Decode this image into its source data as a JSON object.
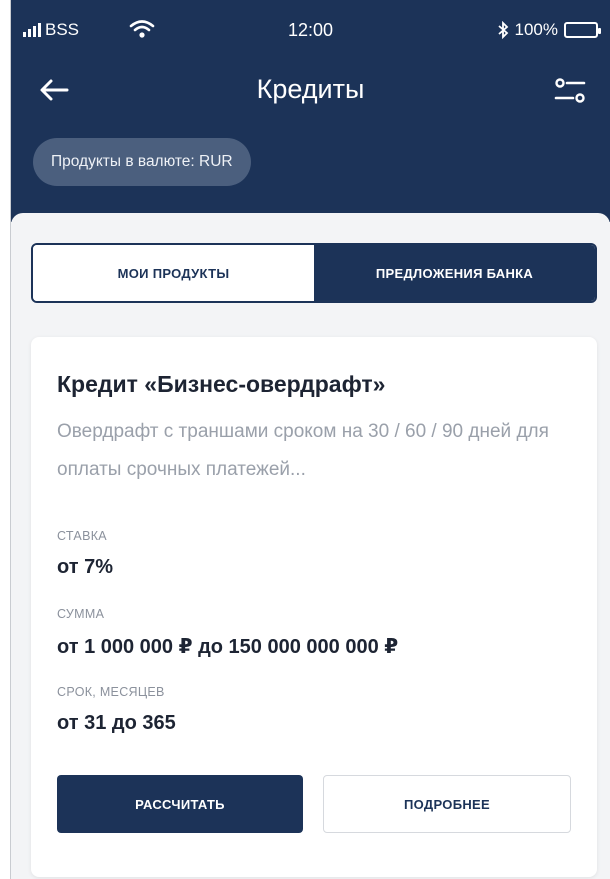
{
  "status_bar": {
    "carrier": "BSS",
    "time": "12:00",
    "battery": "100%",
    "icons": [
      "signal-icon",
      "wifi-icon",
      "bluetooth-icon",
      "battery-icon"
    ]
  },
  "header": {
    "title": "Кредиты",
    "back_icon": "arrow-left-icon",
    "filter_icon": "filter-sliders-icon"
  },
  "currency_chip": {
    "label": "Продукты в валюте: RUR"
  },
  "tabs": [
    {
      "label": "МОИ ПРОДУКТЫ",
      "active": false
    },
    {
      "label": "ПРЕДЛОЖЕНИЯ БАНКА",
      "active": true
    }
  ],
  "product_card": {
    "title": "Кредит «Бизнес-овердрафт»",
    "description": "Овердрафт с траншами сроком на 30 / 60 / 90 дней для оплаты срочных платежей...",
    "params": [
      {
        "label": "СТАВКА",
        "value": "от 7%"
      },
      {
        "label": "СУММА",
        "value": "от 1 000 000 ₽ до 150 000 000 000 ₽"
      },
      {
        "label": "СРОК, МЕСЯЦЕВ",
        "value": "от 31 до 365"
      }
    ],
    "primary_button": "РАССЧИТАТЬ",
    "secondary_button": "ПОДРОБНЕЕ"
  },
  "colors": {
    "brand_navy": "#1c3358",
    "chip_bg": "#4b5f7e",
    "muted_text": "#9aa0aa",
    "background": "#f3f4f6"
  }
}
